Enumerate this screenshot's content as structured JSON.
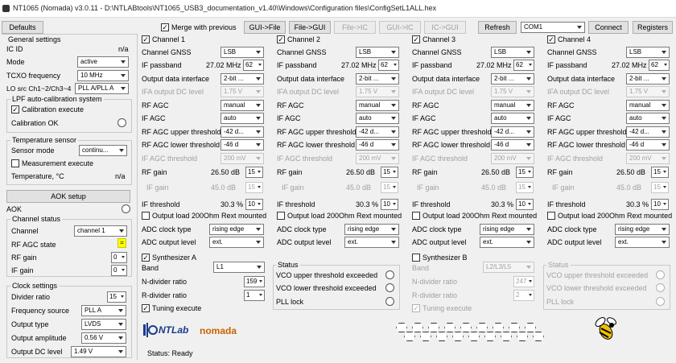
{
  "window": {
    "title": "NT1065 (Nomada) v3.0.11 - D:\\NTLABtools\\NT1065_USB3_documentation_v1.40\\Windows\\Configuration files\\ConfigSetL1ALL.hex"
  },
  "toolbar": {
    "defaults": "Defaults",
    "merge_label": "Merge with previous",
    "merge_checked": "✓",
    "gui_to_file": "GUI->File",
    "file_to_gui": "File->GUI",
    "file_to_ic": "File->IC",
    "gui_to_ic": "GUI->IC",
    "ic_to_gui": "IC->GUI",
    "refresh": "Refresh",
    "port": "COM1",
    "connect": "Connect",
    "registers": "Registers"
  },
  "general": {
    "title": "General settings",
    "ic_id_label": "IC ID",
    "ic_id_value": "n/a",
    "mode_label": "Mode",
    "mode_value": "active",
    "tcxo_label": "TCXO frequency",
    "tcxo_value": "10 MHz",
    "lo_label": "LO src Ch1~2/Ch3~4",
    "lo_value": "PLL A/PLL A"
  },
  "lpf": {
    "title": "LPF auto-calibration system",
    "cal_exec": "Calibration execute",
    "cal_ok": "Calibration OK"
  },
  "temp": {
    "title": "Temperature sensor",
    "mode_label": "Sensor mode",
    "mode_value": "continu...",
    "meas_exec": "Measurement execute",
    "temp_label": "Temperature, °C",
    "temp_value": "n/a"
  },
  "aok": {
    "setup": "AOK setup",
    "label": "AOK"
  },
  "chstatus": {
    "title": "Channel status",
    "channel_label": "Channel",
    "channel_value": "channel 1",
    "agc_label": "RF AGC state",
    "agc_value": "=",
    "rfgain_label": "RF gain",
    "rfgain_value": "0",
    "ifgain_label": "IF gain",
    "ifgain_value": "0"
  },
  "clock": {
    "title": "Clock settings",
    "div_label": "Divider ratio",
    "div_value": "15",
    "src_label": "Frequency source",
    "src_value": "PLL A",
    "type_label": "Output type",
    "type_value": "LVDS",
    "amp_label": "Output amplitude",
    "amp_value": "0.56 V",
    "dc_label": "Output DC level",
    "dc_value": "1.49 V"
  },
  "labels": {
    "gnss": "Channel GNSS",
    "passband": "IF passband",
    "odi": "Output data interface",
    "ifa": "IFA output DC level",
    "rfagc": "RF AGC",
    "ifagc": "IF AGC",
    "upper": "RF AGC upper threshold",
    "lower": "RF AGC lower threshold",
    "ifagc_th": "IF AGC threshold",
    "rfgain": "RF gain",
    "ifgain": "IF gain",
    "ifth": "IF threshold",
    "load": "Output load 200Ohm Rext mounted",
    "clkedge": "ADC clock type",
    "adclvl": "ADC output level"
  },
  "channels": [
    {
      "name": "Channel 1",
      "checked": "✓",
      "gnss": "LSB",
      "passband": "27.02 MHz",
      "passband_idx": "62",
      "odi": "2-bit ...",
      "ifa": "1.75 V",
      "rfagc": "manual",
      "ifagc": "auto",
      "upper": "-42 d...",
      "lower": "-46 d",
      "ifagc_th": "200 mV",
      "rfgain": "26.50 dB",
      "rfgain_idx": "15",
      "ifgain": "45.0 dB",
      "ifgain_idx": "15",
      "ifth": "30.3 %",
      "ifth_idx": "10",
      "clkedge": "rising edge",
      "adclvl": "ext."
    },
    {
      "name": "Channel 2",
      "checked": "✓",
      "gnss": "LSB",
      "passband": "27.02 MHz",
      "passband_idx": "62",
      "odi": "2-bit ...",
      "ifa": "1.75 V",
      "rfagc": "manual",
      "ifagc": "auto",
      "upper": "-42 d...",
      "lower": "-46 d",
      "ifagc_th": "200 mV",
      "rfgain": "26.50 dB",
      "rfgain_idx": "15",
      "ifgain": "45.0 dB",
      "ifgain_idx": "15",
      "ifth": "30.3 %",
      "ifth_idx": "10",
      "clkedge": "rising edge",
      "adclvl": "ext."
    },
    {
      "name": "Channel 3",
      "checked": "✓",
      "gnss": "LSB",
      "passband": "27.02 MHz",
      "passband_idx": "62",
      "odi": "2-bit ...",
      "ifa": "1.75 V",
      "rfagc": "manual",
      "ifagc": "auto",
      "upper": "-42 d...",
      "lower": "-46 d",
      "ifagc_th": "200 mV",
      "rfgain": "26.50 dB",
      "rfgain_idx": "15",
      "ifgain": "45.0 dB",
      "ifgain_idx": "15",
      "ifth": "30.3 %",
      "ifth_idx": "10",
      "clkedge": "rising edge",
      "adclvl": "ext."
    },
    {
      "name": "Channel 4",
      "checked": "✓",
      "gnss": "LSB",
      "passband": "27.02 MHz",
      "passband_idx": "62",
      "odi": "2-bit ...",
      "ifa": "1.75 V",
      "rfagc": "manual",
      "ifagc": "auto",
      "upper": "-42 d...",
      "lower": "-46 d",
      "ifagc_th": "200 mV",
      "rfgain": "26.50 dB",
      "rfgain_idx": "15",
      "ifgain": "45.0 dB",
      "ifgain_idx": "15",
      "ifth": "30.3 %",
      "ifth_idx": "10",
      "clkedge": "rising edge",
      "adclvl": "ext."
    }
  ],
  "synthA": {
    "title": "Synthesizer A",
    "checked": "✓",
    "band_label": "Band",
    "band_value": "L1",
    "n_label": "N-divider ratio",
    "n_value": "159",
    "r_label": "R-divider ratio",
    "r_value": "1",
    "tune": "Tuning execute",
    "tune_checked": "✓"
  },
  "statusA": {
    "title": "Status",
    "upper": "VCO upper threshold exceeded",
    "lower": "VCO lower threshold exceeded",
    "lock": "PLL lock"
  },
  "synthB": {
    "title": "Synthesizer B",
    "band_label": "Band",
    "band_value": "L2/L3/L5",
    "n_label": "N-divider ratio",
    "n_value": "247",
    "r_label": "R-divider ratio",
    "r_value": "2",
    "tune": "Tuning execute",
    "tune_checked": "✓"
  },
  "statusB": {
    "title": "Status",
    "upper": "VCO upper threshold exceeded",
    "lower": "VCO lower threshold exceeded",
    "lock": "PLL lock"
  },
  "logos": {
    "ntlab": "NTLab",
    "nomada": "nomada"
  },
  "statusbar": {
    "text": "Status: Ready"
  },
  "colors": {
    "yellow": "#ffff00",
    "nomada": "#c86400",
    "ntlab": "#1a3c8c"
  }
}
